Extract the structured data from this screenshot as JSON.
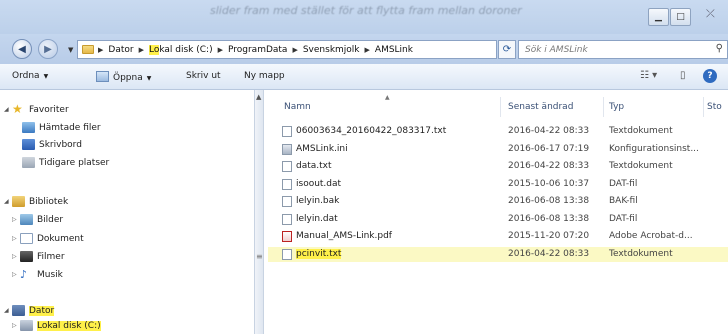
{
  "title_blurred": "slider fram med stället för att flytta fram mellan doroner",
  "window_buttons": {
    "minimize": "▁",
    "maximize": "□",
    "close": "⤫"
  },
  "breadcrumbs": [
    "Dator",
    "Lokal disk (C:)",
    "ProgramData",
    "Svenskmjolk",
    "AMSLink"
  ],
  "breadcrumb_highlight": "Lo",
  "search_placeholder": "Sök i AMSLink",
  "toolbar": {
    "organize": "Ordna",
    "open": "Öppna",
    "print": "Skriv ut",
    "new_folder": "Ny mapp"
  },
  "nav": {
    "favorites": "Favoriter",
    "downloads": "Hämtade filer",
    "desktop": "Skrivbord",
    "recent": "Tidigare platser",
    "libraries": "Bibliotek",
    "pictures": "Bilder",
    "documents": "Dokument",
    "videos": "Filmer",
    "music": "Musik",
    "computer": "Dator",
    "local_disk": "Lokal disk (C:)"
  },
  "columns": {
    "name": "Namn",
    "modified": "Senast ändrad",
    "type": "Typ",
    "size": "Sto"
  },
  "files": [
    {
      "name": "06003634_20160422_083317.txt",
      "date": "2016-04-22 08:33",
      "type": "Textdokument",
      "icon": "txt"
    },
    {
      "name": "AMSLink.ini",
      "date": "2016-06-17 07:19",
      "type": "Konfigurationsinst...",
      "icon": "cfg"
    },
    {
      "name": "data.txt",
      "date": "2016-04-22 08:33",
      "type": "Textdokument",
      "icon": "txt"
    },
    {
      "name": "isoout.dat",
      "date": "2015-10-06 10:37",
      "type": "DAT-fil",
      "icon": "txt"
    },
    {
      "name": "lelyin.bak",
      "date": "2016-06-08 13:38",
      "type": "BAK-fil",
      "icon": "txt"
    },
    {
      "name": "lelyin.dat",
      "date": "2016-06-08 13:38",
      "type": "DAT-fil",
      "icon": "txt"
    },
    {
      "name": "Manual_AMS-Link.pdf",
      "date": "2015-11-20 07:20",
      "type": "Adobe Acrobat-d...",
      "icon": "pdf"
    },
    {
      "name": "pcinvit.txt",
      "date": "2016-04-22 08:33",
      "type": "Textdokument",
      "icon": "txt",
      "highlight": true
    }
  ],
  "highlight_color": "#fff04a"
}
